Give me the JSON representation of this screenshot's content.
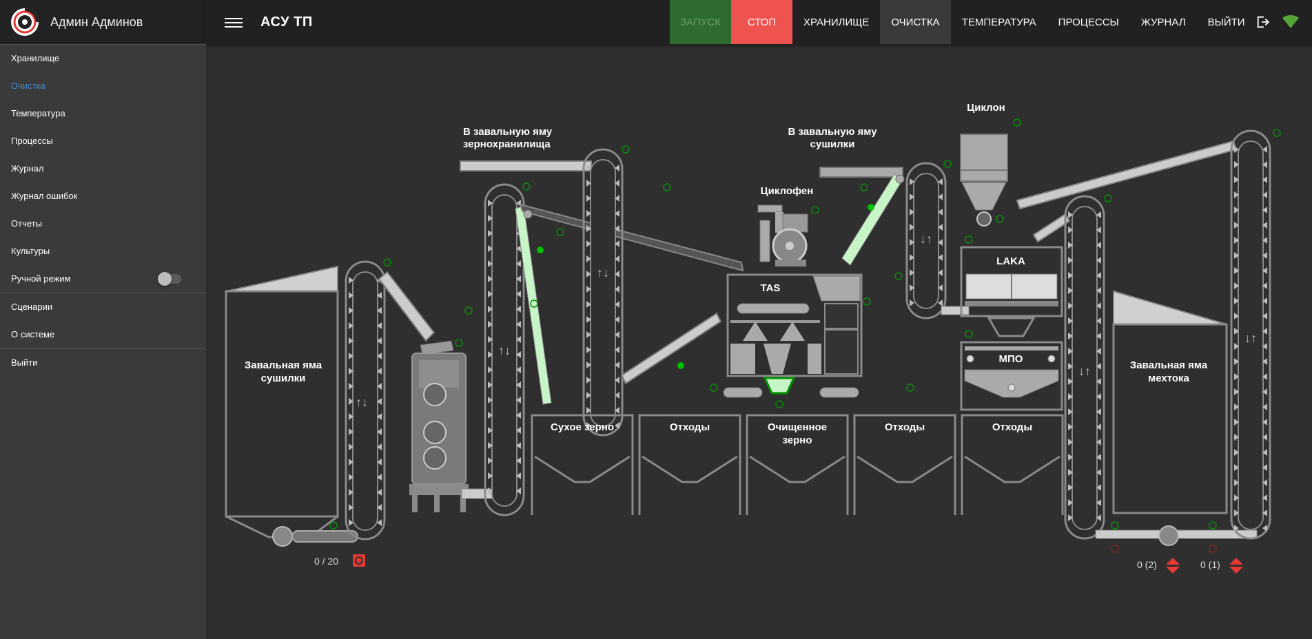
{
  "user": {
    "name": "Админ Админов"
  },
  "app": {
    "title": "АСУ ТП"
  },
  "sidebar": {
    "items": [
      {
        "label": "Хранилище"
      },
      {
        "label": "Очистка"
      },
      {
        "label": "Температура"
      },
      {
        "label": "Процессы"
      },
      {
        "label": "Журнал"
      },
      {
        "label": "Журнал ошибок"
      },
      {
        "label": "Отчеты"
      },
      {
        "label": "Культуры"
      },
      {
        "label": "Ручной режим"
      },
      {
        "label": "Сценарии"
      },
      {
        "label": "О системе"
      },
      {
        "label": "Выйти"
      }
    ]
  },
  "topnav": {
    "start": "ЗАПУСК",
    "stop": "СТОП",
    "storage": "ХРАНИЛИЩЕ",
    "cleaning": "ОЧИСТКА",
    "temperature": "ТЕМПЕРАТУРА",
    "processes": "ПРОЦЕССЫ",
    "journal": "ЖУРНАЛ",
    "logout": "ВЫЙТИ",
    "icons": [
      "logout-icon",
      "wifi-icon",
      "fullscreen-icon"
    ]
  },
  "scheme": {
    "to_storage_pit": [
      "В завальную яму",
      "зернохранилища"
    ],
    "to_dryer_pit": [
      "В завальную яму",
      "сушилки"
    ],
    "cyclone": "Циклон",
    "cyclofan": "Циклофен",
    "tas": "TAS",
    "laka": "LAKA",
    "mpo": "МПО",
    "dryer_pit": [
      "Завальная яма",
      "сушилки"
    ],
    "scrap_pit": [
      "Завальная яма",
      "мехтока"
    ],
    "bins": [
      {
        "label": [
          "Сухое зерно"
        ]
      },
      {
        "label": [
          "Отходы"
        ]
      },
      {
        "label": [
          "Очищенное",
          "зерно"
        ]
      },
      {
        "label": [
          "Отходы"
        ]
      },
      {
        "label": [
          "Отходы"
        ]
      }
    ],
    "counter_main": "0 / 20",
    "counter_right1": "0 (2)",
    "counter_right2": "0 (1)"
  },
  "colors": {
    "accent_blue": "#3d8bd9",
    "stop_red": "#ef5350",
    "start_green": "#2e6b2e",
    "active_flow": "#c8f5c8",
    "indicator_green": "#00c000"
  }
}
